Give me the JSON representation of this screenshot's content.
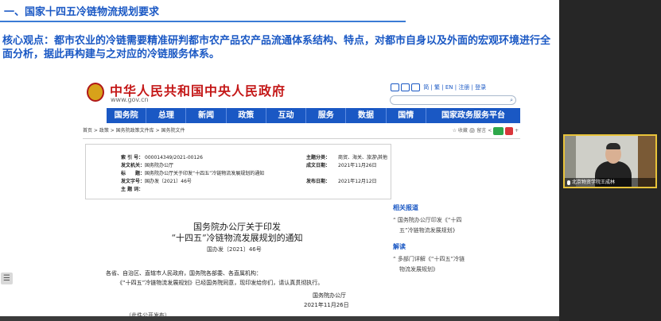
{
  "slide": {
    "section_title": "一、国家十四五冷链物流规划要求",
    "core_point": "核心观点：都市农业的冷链需要精准研判都市农产品农产品流通体系结构、特点，对都市自身以及外面的宏观环境进行全面分析，据此再构建与之对应的冷链服务体系。"
  },
  "gov": {
    "site_name": "中华人民共和国中央人民政府",
    "site_url": "www.gov.cn",
    "toplinks": "简 | 繁 | EN | 注册 | 登录",
    "nav": [
      "国务院",
      "总理",
      "新闻",
      "政策",
      "互动",
      "服务",
      "数据",
      "国情",
      "国家政务服务平台"
    ],
    "breadcrumb": "首页 > 政策 > 国务院政策文件库 > 国务院文件",
    "share_labels": "☆ 收藏  🖨 留言  <",
    "meta_left": [
      {
        "k": "索 引 号：",
        "v": "000014349/2021-00126"
      },
      {
        "k": "发文机关：",
        "v": "国务院办公厅"
      },
      {
        "k": "标　　题：",
        "v": "国务院办公厅关于印发“十四五”冷链物流发展规划的通知"
      },
      {
        "k": "发文字号：",
        "v": "国办发〔2021〕46号"
      },
      {
        "k": "主 题 词：",
        "v": ""
      }
    ],
    "meta_right": [
      {
        "k": "主题分类：",
        "v": "商贸、海关、旅游\\其他"
      },
      {
        "k": "成文日期：",
        "v": "2021年11月26日"
      },
      {
        "k": "",
        "v": ""
      },
      {
        "k": "发布日期：",
        "v": "2021年12月12日"
      }
    ],
    "notice_title_1": "国务院办公厅关于印发",
    "notice_title_2": "“十四五”冷链物流发展规划的通知",
    "doc_no": "国办发〔2021〕46号",
    "body_line_1": "各省、自治区、直辖市人民政府，国务院各部委、各直属机构：",
    "body_line_2": "《“十四五”冷链物流发展规划》已经国务院同意，现印发给你们，请认真贯彻执行。",
    "signer": "国务院办公厅",
    "sign_date": "2021年11月26日",
    "bottom_note": "（此件公开发布）",
    "related_head": "相关报道",
    "related_1": "“ 国务院办公厅印发《“十四",
    "related_2": "五”冷链物流发展规划》",
    "interp_head": "解读",
    "interp_1": "“ 多部门详解《“十四五”冷链",
    "interp_2": "物流发展规划》"
  },
  "video": {
    "caption": "北京物资学院王成林"
  }
}
